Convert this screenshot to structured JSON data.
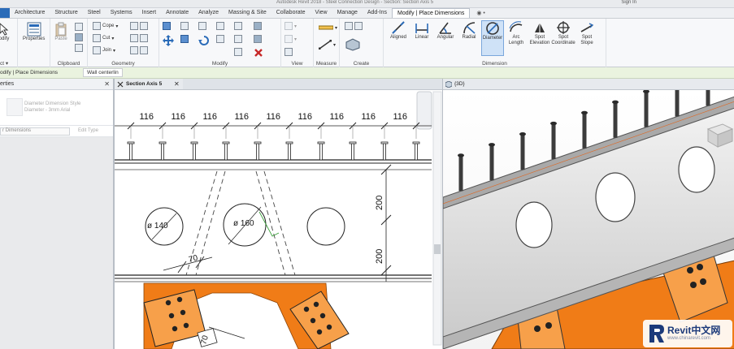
{
  "window": {
    "title": "Autodesk Revit 2018 - Steel Connection Design - Section: Section Axis 5",
    "user": "Sign In"
  },
  "tabs": [
    {
      "label": "",
      "active": false,
      "file": true
    },
    {
      "label": "Architecture"
    },
    {
      "label": "Structure"
    },
    {
      "label": "Steel"
    },
    {
      "label": "Systems"
    },
    {
      "label": "Insert"
    },
    {
      "label": "Annotate"
    },
    {
      "label": "Analyze"
    },
    {
      "label": "Massing & Site"
    },
    {
      "label": "Collaborate"
    },
    {
      "label": "View"
    },
    {
      "label": "Manage"
    },
    {
      "label": "Add-Ins"
    },
    {
      "label": "Modify | Place Dimensions",
      "active": true
    }
  ],
  "tab_extra": "◉ •",
  "ribbon": {
    "panels": {
      "select": "ct ▾",
      "properties": "Properties",
      "clipboard": "Clipboard",
      "geometry": "Geometry",
      "modify": "Modify",
      "view": "View",
      "measure": "Measure",
      "create": "Create",
      "dimension": "Dimension"
    },
    "buttons": {
      "modify": "odify",
      "properties": "Properties",
      "paste": "Paste",
      "cope": "Cope",
      "cut": "Cut",
      "join": "Join"
    },
    "dimension_tools": [
      {
        "label": "Aligned"
      },
      {
        "label": "Linear"
      },
      {
        "label": "Angular"
      },
      {
        "label": "Radial"
      },
      {
        "label": "Diameter",
        "selected": true
      },
      {
        "label": "Arc Length"
      },
      {
        "label": "Spot Elevation"
      },
      {
        "label": "Spot Coordinate"
      },
      {
        "label": "Spot Slope"
      }
    ]
  },
  "context_bar": {
    "label": "odify | Place Dimensions",
    "wall_dropdown": "Wall centerlin"
  },
  "properties": {
    "title": "erties",
    "type_line1": "Diameter Dimension Style",
    "type_line2": "Diameter - 3mm Arial",
    "selector": "r Dimensions",
    "edit_type": "Edit Type"
  },
  "views": {
    "section": {
      "title": "Section Axis 5"
    },
    "threed": {
      "title": "{3D}"
    }
  },
  "drawing": {
    "top_dimensions": [
      "116",
      "116",
      "116",
      "116",
      "116",
      "116",
      "116",
      "116",
      "116"
    ],
    "right_dimensions": [
      "200",
      "200"
    ],
    "hole_labels": [
      "ø 140",
      "ø 160"
    ],
    "plate_dimensions": [
      "70",
      "70"
    ]
  },
  "colors": {
    "accent": "#2a6bb8",
    "steel_plate": "#f07c17",
    "context_bar": "#eaf3df",
    "selected_tool": "#cfe2f7"
  },
  "watermark": {
    "brand": "Revit中文网",
    "url": "www.chinarevit.com"
  }
}
